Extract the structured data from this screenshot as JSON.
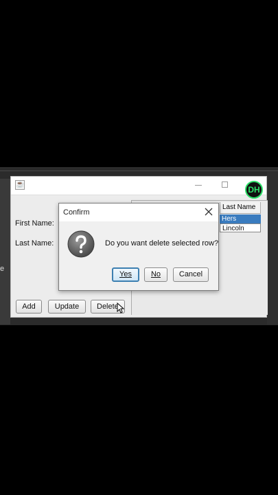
{
  "form": {
    "first_name_label": "First Name:",
    "last_name_label": "Last Name:",
    "add_label": "Add",
    "update_label": "Update",
    "delete_label": "Delete"
  },
  "table": {
    "header": "Last Name",
    "rows": [
      "Hers",
      "Lincoln"
    ],
    "selected_row_color": "#3a7cbf"
  },
  "logo": {
    "text": "DH"
  },
  "background": {
    "left_text": "e"
  },
  "dialog": {
    "title": "Confirm",
    "message": "Do you want delete selected row?",
    "yes_label": "Yes",
    "no_label": "No",
    "cancel_label": "Cancel",
    "icon": "question-icon",
    "accent": "#3c7fb1"
  }
}
